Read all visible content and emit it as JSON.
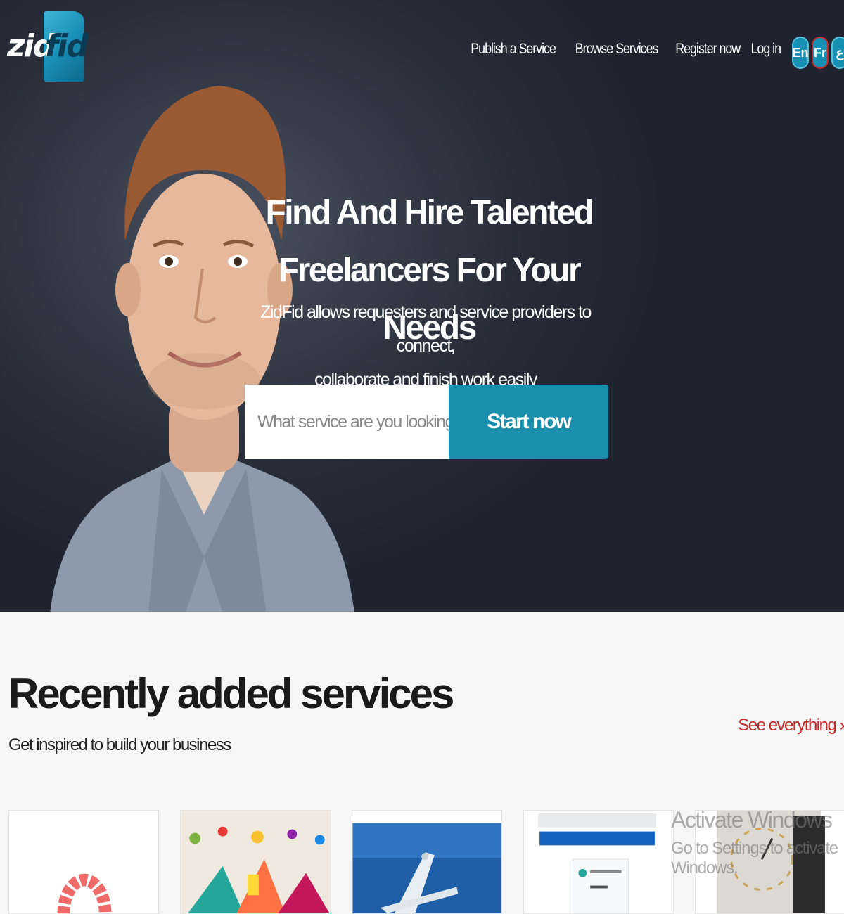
{
  "brand": {
    "logo_left": "zid",
    "logo_right": "fid"
  },
  "nav": {
    "items": [
      "Publish a Service",
      "Browse Services",
      "Register now",
      "Log in"
    ],
    "languages": [
      "En",
      "Fr",
      "ع"
    ]
  },
  "hero": {
    "headline_line1": "Find And Hire Talented Freelancers For Your",
    "headline_line2": "Needs",
    "subline_line1": "ZidFid allows requesters and service providers to connect,",
    "subline_line2": "collaborate and finish work easily",
    "search_placeholder": "What service are you looking for",
    "cta_label": "Start now"
  },
  "recent": {
    "title": "Recently added services",
    "subtitle": "Get inspired to build your business",
    "see_all": "See everything ›"
  },
  "system": {
    "activate_line1": "Activate Windows",
    "activate_line2": "Go to Settings to activate Windows."
  },
  "colors": {
    "accent": "#1a8fab",
    "link_red": "#c62828",
    "hero_bg": "#262b37"
  }
}
